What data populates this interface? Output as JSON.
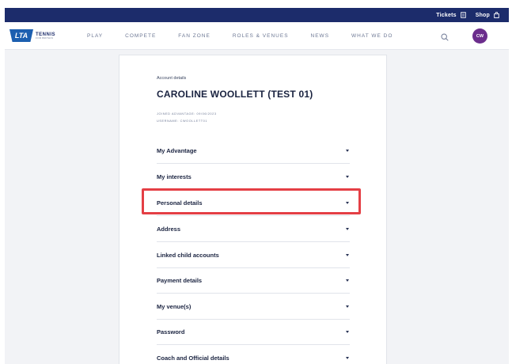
{
  "topbar": {
    "tickets_label": "Tickets",
    "shop_label": "Shop"
  },
  "logo": {
    "badge": "LTA",
    "line1": "TENNIS",
    "line2": "FOR BRITAIN"
  },
  "nav": {
    "items": [
      "PLAY",
      "COMPETE",
      "FAN ZONE",
      "ROLES & VENUES",
      "NEWS",
      "WHAT WE DO"
    ]
  },
  "user": {
    "initials": "CW"
  },
  "account": {
    "section_label": "Account details",
    "name": "CAROLINE WOOLLETT (TEST 01)",
    "joined": "JOINED ADVANTAGE: 09/06/2023",
    "username": "USERNAME: CWOOLLETT01"
  },
  "sections": [
    "My Advantage",
    "My interests",
    "Personal details",
    "Address",
    "Linked child accounts",
    "Payment details",
    "My venue(s)",
    "Password",
    "Coach and Official details"
  ],
  "colors": {
    "navy": "#1c2c6b",
    "highlight": "#e43f45",
    "avatar": "#6b2d8c",
    "logo_blue": "#1c5fb0"
  }
}
